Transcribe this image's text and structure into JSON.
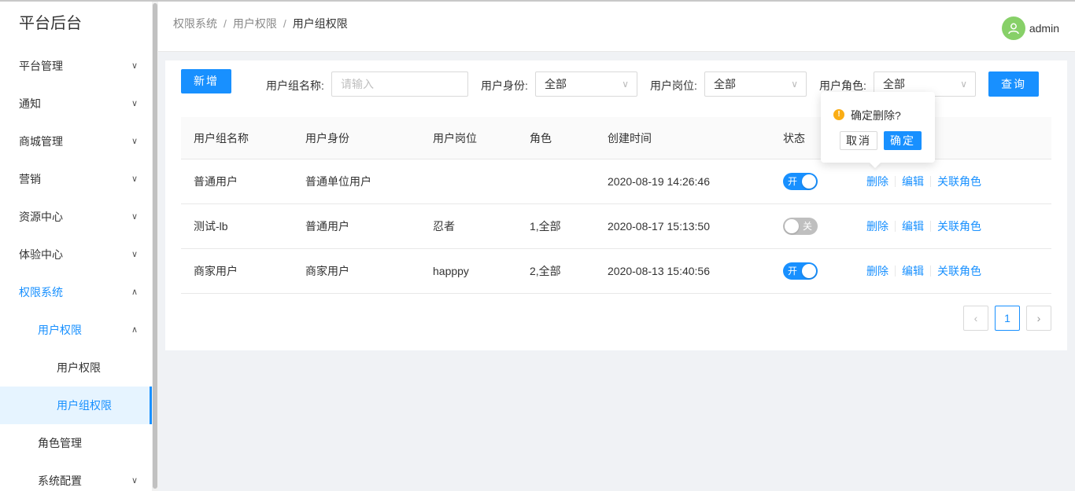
{
  "sidebar": {
    "title": "平台后台",
    "items": [
      {
        "label": "平台管理",
        "arrow": "⌄"
      },
      {
        "label": "通知",
        "arrow": "⌄"
      },
      {
        "label": "商城管理",
        "arrow": "⌄"
      },
      {
        "label": "营销",
        "arrow": "⌄"
      },
      {
        "label": "资源中心",
        "arrow": "⌄"
      },
      {
        "label": "体验中心",
        "arrow": "⌄"
      },
      {
        "label": "权限系统",
        "arrow": "⌃"
      },
      {
        "label": "用户权限",
        "arrow": "⌃"
      },
      {
        "label": "用户权限"
      },
      {
        "label": "用户组权限"
      },
      {
        "label": "角色管理"
      },
      {
        "label": "系统配置",
        "arrow": "⌄"
      }
    ]
  },
  "header": {
    "breadcrumb": [
      "权限系统",
      "用户权限",
      "用户组权限"
    ],
    "breadcrumb_sep": "/",
    "username": "admin"
  },
  "filters": {
    "new_button": "新增",
    "group_name_label": "用户组名称:",
    "group_name_placeholder": "请输入",
    "identity_label": "用户身份:",
    "identity_value": "全部",
    "position_label": "用户岗位:",
    "position_value": "全部",
    "role_label": "用户角色:",
    "role_value": "全部",
    "query_button": "查询"
  },
  "table": {
    "columns": [
      "用户组名称",
      "用户身份",
      "用户岗位",
      "角色",
      "创建时间",
      "状态"
    ],
    "rows": [
      {
        "name": "普通用户",
        "identity": "普通单位用户",
        "position": "",
        "role": "",
        "created": "2020-08-19 14:26:46",
        "status": "开",
        "enabled": true
      },
      {
        "name": "测试-lb",
        "identity": "普通用户",
        "position": "忍者",
        "role": "1,全部",
        "created": "2020-08-17 15:13:50",
        "status": "关",
        "enabled": false
      },
      {
        "name": "商家用户",
        "identity": "商家用户",
        "position": "happpy",
        "role": "2,全部",
        "created": "2020-08-13 15:40:56",
        "status": "开",
        "enabled": true
      }
    ],
    "actions": {
      "delete": "删除",
      "edit": "编辑",
      "link_role": "关联角色"
    }
  },
  "pagination": {
    "prev": "‹",
    "current": "1",
    "next": "›"
  },
  "popconfirm": {
    "icon": "!",
    "message": "确定删除?",
    "cancel": "取消",
    "ok": "确定"
  },
  "colors": {
    "primary": "#1890ff",
    "warning": "#faad14",
    "avatar": "#87d068",
    "switch_off": "#bfbfbf"
  }
}
